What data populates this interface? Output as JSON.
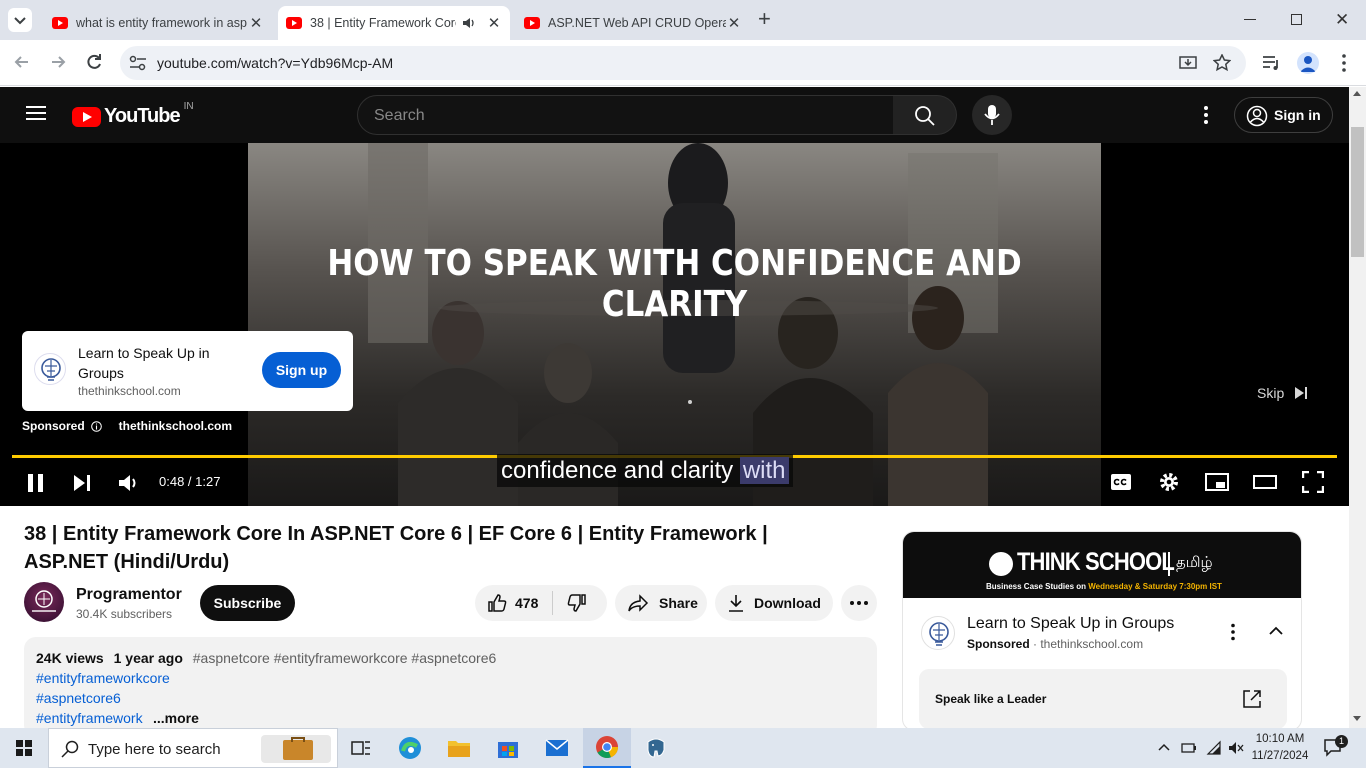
{
  "browser": {
    "tabs": [
      {
        "title": "what is entity framework in asp",
        "active": false
      },
      {
        "title": "38 | Entity Framework Core",
        "active": true
      },
      {
        "title": "ASP.NET Web API CRUD Operat",
        "active": false
      }
    ],
    "url": "youtube.com/watch?v=Ydb96Mcp-AM"
  },
  "youtube": {
    "logo_text": "YouTube",
    "region": "IN",
    "search_placeholder": "Search",
    "signin_label": "Sign in"
  },
  "player": {
    "overlay_heading": "HOW TO SPEAK WITH CONFIDENCE AND CLARITY",
    "ad_card": {
      "title": "Learn to Speak Up in Groups",
      "domain": "thethinkschool.com",
      "cta": "Sign up"
    },
    "sponsored_label": "Sponsored",
    "sponsored_domain": "thethinkschool.com",
    "skip_label": "Skip",
    "caption_main": "confidence and clarity",
    "caption_highlight": "with",
    "time": "0:48 / 1:27",
    "progress_fraction": 1.0
  },
  "video": {
    "title": "38 | Entity Framework Core In ASP.NET Core 6 | EF Core 6 | Entity Framework | ASP.NET (Hindi/Urdu)",
    "channel": "Programentor",
    "subscribers": "30.4K subscribers",
    "subscribe_label": "Subscribe",
    "likes": "478",
    "share_label": "Share",
    "download_label": "Download",
    "views": "24K views",
    "age": "1 year ago",
    "hashtags_line": "#aspnetcore #entityframeworkcore #aspnetcore6",
    "tags": [
      "#entityframeworkcore",
      "#aspnetcore6",
      "#entityframework"
    ],
    "more_label": "...more"
  },
  "side_ad": {
    "banner_title": "THINK SCHOOL",
    "banner_lang": "தமிழ்",
    "banner_sub_prefix": "Business Case Studies on ",
    "banner_sub_days": "Wednesday & Saturday 7:30pm IST",
    "title": "Learn to Speak Up in Groups",
    "sponsored": "Sponsored",
    "domain": "thethinkschool.com",
    "cta": "Speak like a Leader"
  },
  "taskbar": {
    "search_placeholder": "Type here to search",
    "time": "10:10 AM",
    "date": "11/27/2024",
    "notification_count": "1"
  },
  "colors": {
    "youtube_red": "#ff0000",
    "progress_yellow": "#ffcc00",
    "link_blue": "#065fd4",
    "signup_blue": "#065fd4"
  }
}
